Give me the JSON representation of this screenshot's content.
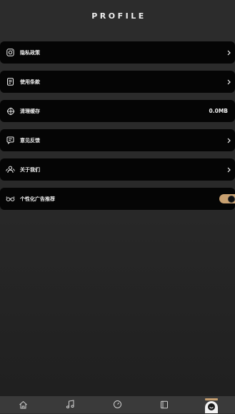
{
  "header": {
    "title": "PROFILE"
  },
  "settings": {
    "items": [
      {
        "label": "隐私政策",
        "icon": "camera-icon",
        "value": "",
        "control": "chevron"
      },
      {
        "label": "使用条款",
        "icon": "document-icon",
        "value": "",
        "control": "chevron"
      },
      {
        "label": "清理缓存",
        "icon": "broom-icon",
        "value": "0.0MB",
        "control": "none"
      },
      {
        "label": "意见反馈",
        "icon": "feedback-icon",
        "value": "",
        "control": "chevron"
      },
      {
        "label": "关于我们",
        "icon": "people-icon",
        "value": "",
        "control": "chevron"
      },
      {
        "label": "个性化广告推荐",
        "icon": "glasses-icon",
        "value": "",
        "control": "toggle",
        "toggle_on": true
      }
    ]
  },
  "tabbar": {
    "tabs": [
      {
        "icon": "home-icon",
        "active": false
      },
      {
        "icon": "music-note-icon",
        "active": false
      },
      {
        "icon": "timer-icon",
        "active": false
      },
      {
        "icon": "book-icon",
        "active": false
      },
      {
        "icon": "profile-face-icon",
        "active": true
      }
    ]
  },
  "colors": {
    "background": "#2a2a2a",
    "card": "#050505",
    "accent": "#c8a070",
    "tabbar": "#3a3a3a",
    "text": "#f2f2f2"
  }
}
